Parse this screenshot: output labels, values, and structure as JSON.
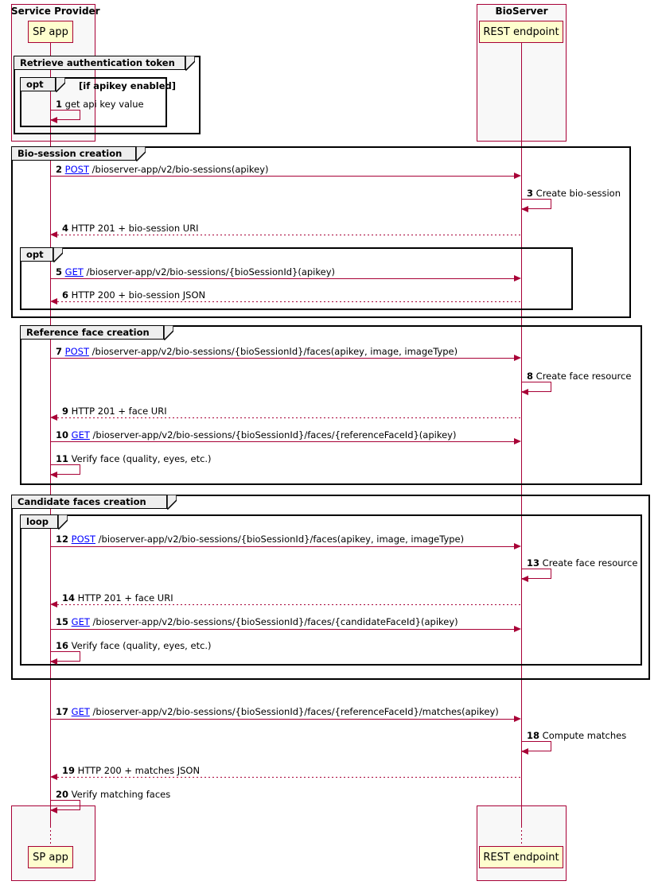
{
  "diagram": {
    "type": "uml-sequence-diagram",
    "colors": {
      "lifeline": "#A80036",
      "participant_fill": "#FEFECE",
      "package_fill": "#F8F8F8",
      "frame_border": "#000000",
      "frame_tab_fill": "#EEEEEE",
      "verb_link": "#0000FF"
    }
  },
  "packages": [
    {
      "title": "Service Provider"
    },
    {
      "title": "BioServer"
    }
  ],
  "participants": [
    {
      "name": "SP app"
    },
    {
      "name": "REST endpoint"
    }
  ],
  "participants_footer": [
    {
      "name": "SP app"
    },
    {
      "name": "REST endpoint"
    }
  ],
  "frames": [
    {
      "kind": "group",
      "label": "Retrieve authentication token",
      "condition": ""
    },
    {
      "kind": "opt",
      "label": "opt",
      "condition": "[if apikey enabled]"
    },
    {
      "kind": "group",
      "label": "Bio-session creation",
      "condition": ""
    },
    {
      "kind": "opt",
      "label": "opt",
      "condition": ""
    },
    {
      "kind": "group",
      "label": "Reference face creation",
      "condition": ""
    },
    {
      "kind": "group",
      "label": "Candidate faces creation",
      "condition": ""
    },
    {
      "kind": "loop",
      "label": "loop",
      "condition": ""
    }
  ],
  "messages": [
    {
      "num": "1",
      "verb": "",
      "text": "get api key value",
      "kind": "self",
      "from": "SP app",
      "to": "SP app"
    },
    {
      "num": "2",
      "verb": "POST",
      "text": "/bioserver-app/v2/bio-sessions(apikey)",
      "kind": "sync",
      "from": "SP app",
      "to": "REST endpoint"
    },
    {
      "num": "3",
      "verb": "",
      "text": "Create bio-session",
      "kind": "self",
      "from": "REST endpoint",
      "to": "REST endpoint"
    },
    {
      "num": "4",
      "verb": "",
      "text": "HTTP 201 + bio-session URI",
      "kind": "return",
      "from": "REST endpoint",
      "to": "SP app"
    },
    {
      "num": "5",
      "verb": "GET",
      "text": "/bioserver-app/v2/bio-sessions/{bioSessionId}(apikey)",
      "kind": "sync",
      "from": "SP app",
      "to": "REST endpoint"
    },
    {
      "num": "6",
      "verb": "",
      "text": "HTTP 200 + bio-session JSON",
      "kind": "return",
      "from": "REST endpoint",
      "to": "SP app"
    },
    {
      "num": "7",
      "verb": "POST",
      "text": "/bioserver-app/v2/bio-sessions/{bioSessionId}/faces(apikey, image, imageType)",
      "kind": "sync",
      "from": "SP app",
      "to": "REST endpoint"
    },
    {
      "num": "8",
      "verb": "",
      "text": "Create face resource",
      "kind": "self",
      "from": "REST endpoint",
      "to": "REST endpoint"
    },
    {
      "num": "9",
      "verb": "",
      "text": "HTTP 201 + face URI",
      "kind": "return",
      "from": "REST endpoint",
      "to": "SP app"
    },
    {
      "num": "10",
      "verb": "GET",
      "text": "/bioserver-app/v2/bio-sessions/{bioSessionId}/faces/{referenceFaceId}(apikey)",
      "kind": "sync",
      "from": "SP app",
      "to": "REST endpoint"
    },
    {
      "num": "11",
      "verb": "",
      "text": "Verify face (quality, eyes, etc.)",
      "kind": "self",
      "from": "SP app",
      "to": "SP app"
    },
    {
      "num": "12",
      "verb": "POST",
      "text": "/bioserver-app/v2/bio-sessions/{bioSessionId}/faces(apikey, image, imageType)",
      "kind": "sync",
      "from": "SP app",
      "to": "REST endpoint"
    },
    {
      "num": "13",
      "verb": "",
      "text": "Create face resource",
      "kind": "self",
      "from": "REST endpoint",
      "to": "REST endpoint"
    },
    {
      "num": "14",
      "verb": "",
      "text": "HTTP 201 + face URI",
      "kind": "return",
      "from": "REST endpoint",
      "to": "SP app"
    },
    {
      "num": "15",
      "verb": "GET",
      "text": "/bioserver-app/v2/bio-sessions/{bioSessionId}/faces/{candidateFaceId}(apikey)",
      "kind": "sync",
      "from": "SP app",
      "to": "REST endpoint"
    },
    {
      "num": "16",
      "verb": "",
      "text": "Verify face (quality, eyes, etc.)",
      "kind": "self",
      "from": "SP app",
      "to": "SP app"
    },
    {
      "num": "17",
      "verb": "GET",
      "text": "/bioserver-app/v2/bio-sessions/{bioSessionId}/faces/{referenceFaceId}/matches(apikey)",
      "kind": "sync",
      "from": "SP app",
      "to": "REST endpoint"
    },
    {
      "num": "18",
      "verb": "",
      "text": "Compute matches",
      "kind": "self",
      "from": "REST endpoint",
      "to": "REST endpoint"
    },
    {
      "num": "19",
      "verb": "",
      "text": "HTTP 200 + matches JSON",
      "kind": "return",
      "from": "REST endpoint",
      "to": "SP app"
    },
    {
      "num": "20",
      "verb": "",
      "text": "Verify matching faces",
      "kind": "self",
      "from": "SP app",
      "to": "SP app"
    }
  ]
}
